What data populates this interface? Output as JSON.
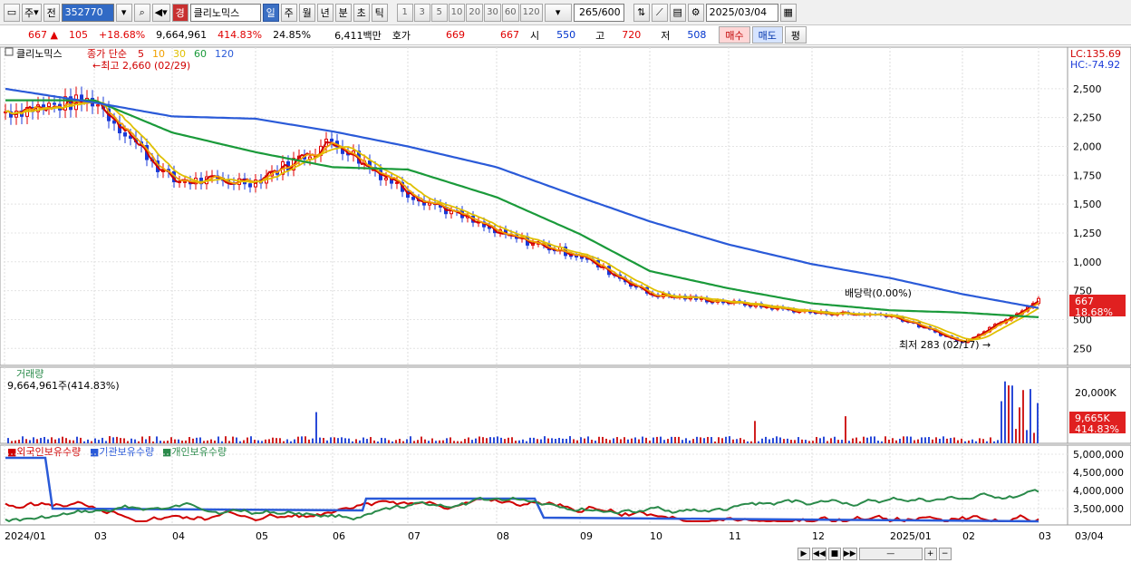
{
  "toolbar": {
    "mode_label": "주",
    "market_label": "전",
    "stock_code": "352770",
    "badge": "경",
    "stock_name": "클리노믹스",
    "period_tabs": [
      "일",
      "주",
      "월",
      "년",
      "분",
      "초",
      "틱"
    ],
    "active_period": "일",
    "interval_buttons": [
      "1",
      "3",
      "5",
      "10",
      "20",
      "30",
      "60",
      "120"
    ],
    "count_value": "265/600",
    "date_value": "2025/03/04"
  },
  "quote": {
    "price": "667",
    "change": "105",
    "change_pct": "+18.68%",
    "volume": "9,664,961",
    "volume_ratio": "414.83%",
    "turnover_rate": "24.85%",
    "amount": "6,411백만",
    "hoga_label": "호가",
    "ask": "669",
    "bid": "667",
    "open_label": "시",
    "open": "550",
    "high_label": "고",
    "high": "720",
    "low_label": "저",
    "low": "508",
    "buy_label": "매수",
    "sell_label": "매도",
    "eval_label": "평"
  },
  "price_panel": {
    "stock_label": "클리노믹스",
    "ma_legend_prefix": "종가 단순",
    "ma_periods": [
      "5",
      "10",
      "30",
      "60",
      "120"
    ],
    "ma_colors": [
      "#d00000",
      "#f0a000",
      "#e0c000",
      "#1a9a3a",
      "#2a5ad8"
    ],
    "high_annotation": "최고 2,660 (02/29)",
    "low_annotation": "최저 283 (02/17)",
    "dividend_annotation": "배당락(0.00%)",
    "lc_label": "LC:135.69",
    "hc_label": "HC:-74.92",
    "last_price_badge": "667",
    "last_change_badge": "18.68%",
    "y_ticks": [
      "2,500",
      "2,250",
      "2,000",
      "1,750",
      "1,500",
      "1,250",
      "1,000",
      "750",
      "500",
      "250"
    ]
  },
  "volume_panel": {
    "title": "거래량",
    "current": "9,664,961주(414.83%)",
    "y_tick": "20,000K",
    "last_badge": "9,665K",
    "last_ratio": "414.83%"
  },
  "holdings_panel": {
    "legend": [
      "외국인보유수량",
      "기관보유수량",
      "개인보유수량"
    ],
    "colors": [
      "#d00000",
      "#2a5ad8",
      "#2a8a4a"
    ],
    "y_ticks": [
      "5,000,000",
      "4,500,000",
      "4,000,000",
      "3,500,000"
    ]
  },
  "x_axis": {
    "labels": [
      "2024/01",
      "03",
      "04",
      "05",
      "06",
      "07",
      "08",
      "09",
      "10",
      "11",
      "12",
      "2025/01",
      "02",
      "03"
    ],
    "right_label": "03/04"
  },
  "chart_data": {
    "type": "candlestick",
    "series": [
      {
        "name": "종가",
        "x": [
          "2024/01",
          "03",
          "04",
          "05",
          "06",
          "07",
          "08",
          "09",
          "10",
          "11",
          "12",
          "2025/01",
          "02",
          "03/04"
        ],
        "values": [
          2300,
          2400,
          1700,
          1700,
          2050,
          1600,
          1250,
          1050,
          720,
          650,
          560,
          540,
          300,
          667
        ]
      },
      {
        "name": "120",
        "x": [
          "2024/01",
          "03",
          "04",
          "05",
          "06",
          "07",
          "08",
          "09",
          "10",
          "11",
          "12",
          "2025/01",
          "02",
          "03/04"
        ],
        "values": [
          2500,
          2380,
          2260,
          2240,
          2130,
          2000,
          1820,
          1560,
          1350,
          1150,
          980,
          860,
          720,
          600
        ]
      },
      {
        "name": "60",
        "x": [
          "2024/01",
          "03",
          "04",
          "05",
          "06",
          "07",
          "08",
          "09",
          "10",
          "11",
          "12",
          "2025/01",
          "02",
          "03/04"
        ],
        "values": [
          2400,
          2400,
          2120,
          1950,
          1820,
          1800,
          1560,
          1240,
          920,
          770,
          640,
          580,
          560,
          520
        ]
      }
    ],
    "ylim": [
      150,
      2750
    ]
  }
}
